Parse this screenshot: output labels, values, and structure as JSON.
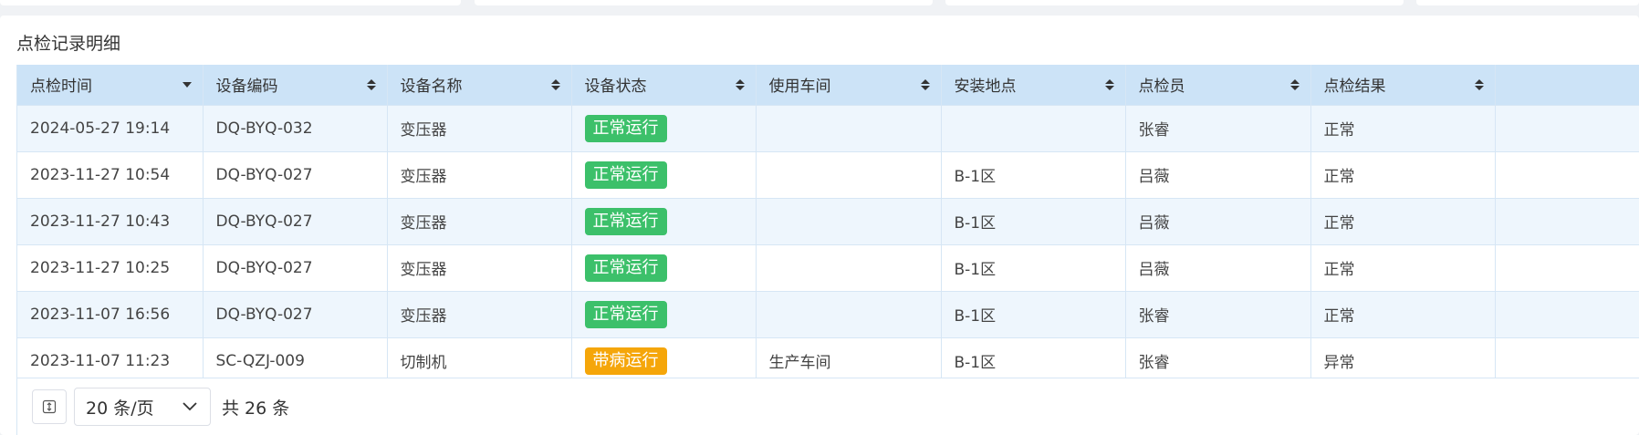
{
  "panel": {
    "title": "点检记录明细"
  },
  "table": {
    "columns": [
      {
        "label": "点检时间",
        "sort": "desc"
      },
      {
        "label": "设备编码",
        "sort": "both"
      },
      {
        "label": "设备名称",
        "sort": "both"
      },
      {
        "label": "设备状态",
        "sort": "both"
      },
      {
        "label": "使用车间",
        "sort": "both"
      },
      {
        "label": "安装地点",
        "sort": "both"
      },
      {
        "label": "点检员",
        "sort": "both"
      },
      {
        "label": "点检结果",
        "sort": "both"
      }
    ],
    "rows": [
      {
        "time": "2024-05-27 19:14",
        "code": "DQ-BYQ-032",
        "name": "变压器",
        "status": "正常运行",
        "status_type": "green",
        "workshop": "",
        "location": "",
        "inspector": "张睿",
        "result": "正常"
      },
      {
        "time": "2023-11-27 10:54",
        "code": "DQ-BYQ-027",
        "name": "变压器",
        "status": "正常运行",
        "status_type": "green",
        "workshop": "",
        "location": "B-1区",
        "inspector": "吕薇",
        "result": "正常"
      },
      {
        "time": "2023-11-27 10:43",
        "code": "DQ-BYQ-027",
        "name": "变压器",
        "status": "正常运行",
        "status_type": "green",
        "workshop": "",
        "location": "B-1区",
        "inspector": "吕薇",
        "result": "正常"
      },
      {
        "time": "2023-11-27 10:25",
        "code": "DQ-BYQ-027",
        "name": "变压器",
        "status": "正常运行",
        "status_type": "green",
        "workshop": "",
        "location": "B-1区",
        "inspector": "吕薇",
        "result": "正常"
      },
      {
        "time": "2023-11-07 16:56",
        "code": "DQ-BYQ-027",
        "name": "变压器",
        "status": "正常运行",
        "status_type": "green",
        "workshop": "",
        "location": "B-1区",
        "inspector": "张睿",
        "result": "正常"
      },
      {
        "time": "2023-11-07 11:23",
        "code": "SC-QZJ-009",
        "name": "切制机",
        "status": "带病运行",
        "status_type": "orange",
        "workshop": "生产车间",
        "location": "B-1区",
        "inspector": "张睿",
        "result": "异常"
      }
    ]
  },
  "pagination": {
    "page_size_label": "20 条/页",
    "total_label": "共 26 条"
  },
  "colors": {
    "header_bg": "#cce3f7",
    "row_stripe": "#eef6fd",
    "status_green": "#3cc06a",
    "status_orange": "#f5a60a"
  }
}
